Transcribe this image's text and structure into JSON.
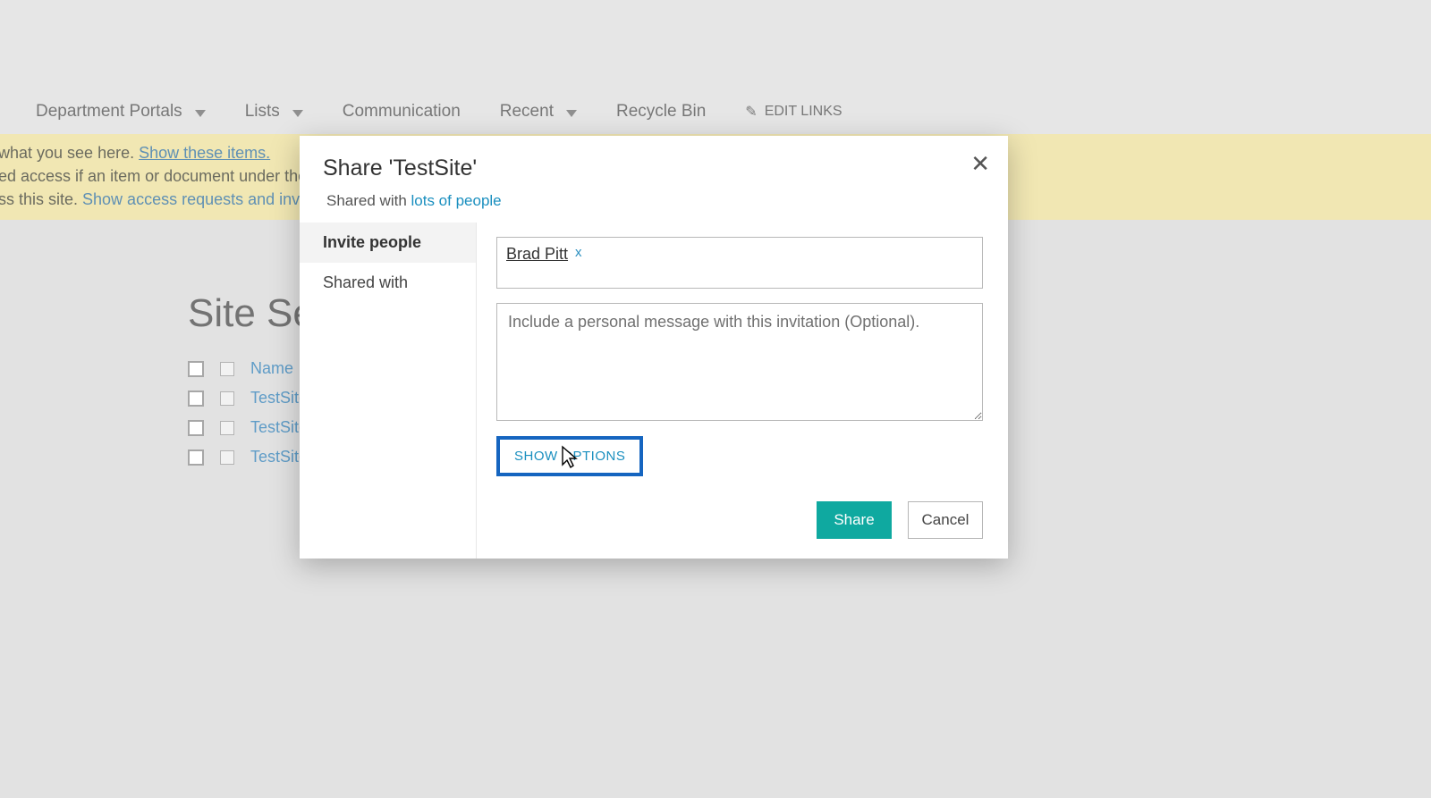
{
  "nav": {
    "items": [
      {
        "label": "Department Portals",
        "hasCaret": true
      },
      {
        "label": "Lists",
        "hasCaret": true
      },
      {
        "label": "Communication",
        "hasCaret": false
      },
      {
        "label": "Recent",
        "hasCaret": true
      },
      {
        "label": "Recycle Bin",
        "hasCaret": false
      }
    ],
    "editLinks": "EDIT LINKS"
  },
  "notice": {
    "line1a": "what you see here. ",
    "line1link": "Show these items.",
    "line2": "ed access if an item or document under the site",
    "line3a": "ss this site. ",
    "line3link": "Show access requests and invitation"
  },
  "pageTitle": "Site Sett",
  "list": {
    "headerName": "Name",
    "rows": [
      "TestSite",
      "TestSite",
      "TestSite"
    ]
  },
  "modal": {
    "title": "Share 'TestSite'",
    "sharedPrefix": "Shared with ",
    "sharedLink": "lots of people",
    "tabs": {
      "invite": "Invite people",
      "sharedWith": "Shared with"
    },
    "personName": "Brad Pitt",
    "personRemove": "x",
    "messagePlaceholder": "Include a personal message with this invitation (Optional).",
    "showOptions": "SHOW OPTIONS",
    "shareBtn": "Share",
    "cancelBtn": "Cancel"
  }
}
